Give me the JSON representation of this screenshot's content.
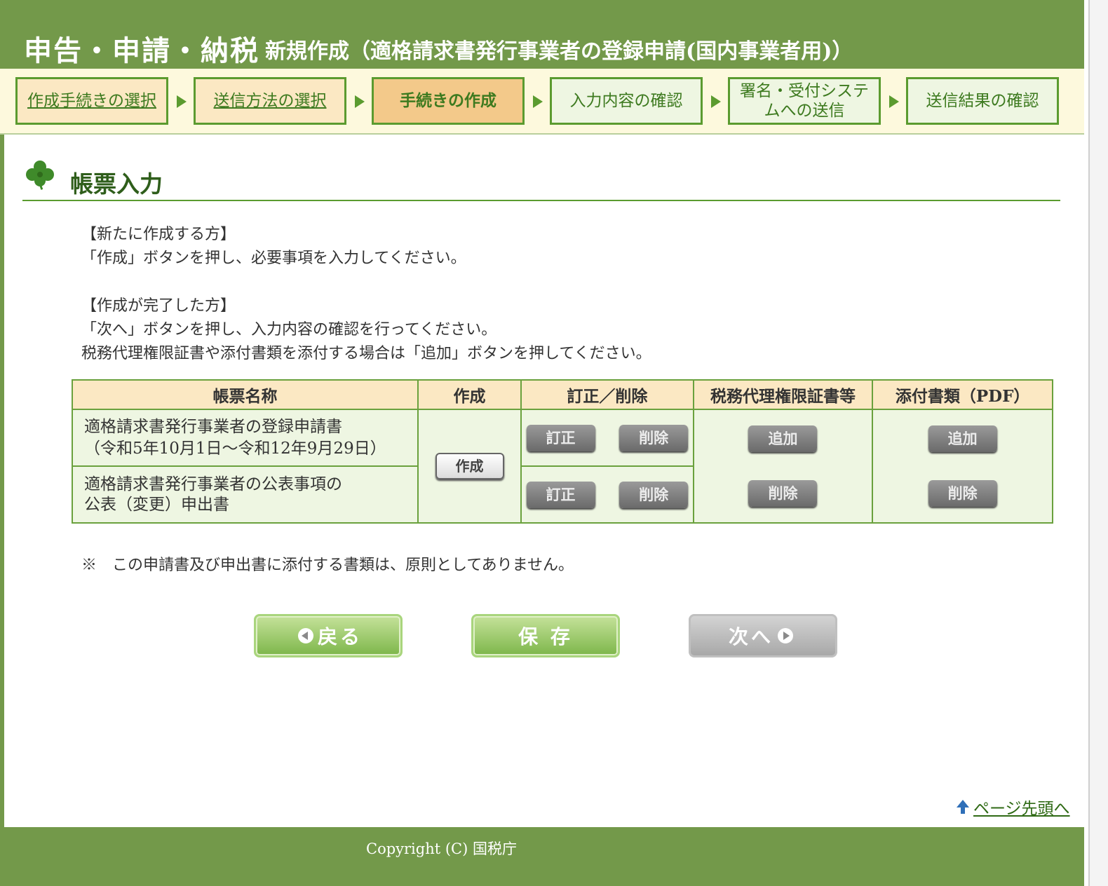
{
  "header": {
    "main_title": "申告・申請・納税",
    "sub_title": "新規作成（適格請求書発行事業者の登録申請(国内事業者用)）"
  },
  "steps": [
    {
      "label": "作成手続きの選択",
      "state": "done"
    },
    {
      "label": "送信方法の選択",
      "state": "done"
    },
    {
      "label": "手続きの作成",
      "state": "current"
    },
    {
      "label": "入力内容の確認",
      "state": "todo"
    },
    {
      "label": "署名・受付システムへの送信",
      "state": "todo"
    },
    {
      "label": "送信結果の確認",
      "state": "todo"
    }
  ],
  "section": {
    "title": "帳票入力",
    "icon": "clover-icon"
  },
  "instructions": {
    "new_heading": "【新たに作成する方】",
    "new_text": "「作成」ボタンを押し、必要事項を入力してください。",
    "done_heading": "【作成が完了した方】",
    "done_text": "「次へ」ボタンを押し、入力内容の確認を行ってください。",
    "attach_text": "税務代理権限証書や添付書類を添付する場合は「追加」ボタンを押してください。"
  },
  "table": {
    "headers": [
      "帳票名称",
      "作成",
      "訂正／削除",
      "税務代理権限証書等",
      "添付書類（PDF）"
    ],
    "rows": [
      {
        "name_line1": "適格請求書発行事業者の登録申請書",
        "name_line2": "（令和5年10月1日～令和12年9月29日）"
      },
      {
        "name_line1": "適格請求書発行事業者の公表事項の",
        "name_line2": "公表（変更）申出書"
      }
    ],
    "create_label": "作成",
    "correct_label": "訂正",
    "delete_label": "削除",
    "add_label": "追加"
  },
  "note": "※　この申請書及び申出書に添付する書類は、原則としてありません。",
  "buttons": {
    "back": "戻る",
    "save": "保 存",
    "next": "次へ"
  },
  "page_top_link": "ページ先頭へ",
  "footer": {
    "copyright": "Copyright (C) 国税庁"
  },
  "colors": {
    "brand_green": "#73994a",
    "step_border": "#5b9b2f",
    "table_header": "#fbe8c3",
    "table_cell": "#eef6e2"
  }
}
